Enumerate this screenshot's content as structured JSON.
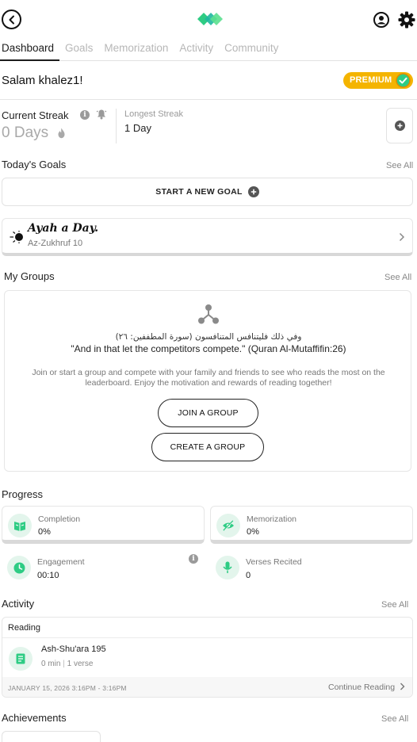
{
  "tabs": [
    "Dashboard",
    "Goals",
    "Memorization",
    "Activity",
    "Community"
  ],
  "greeting": "Salam khalez1!",
  "premium_label": "PREMIUM",
  "streak": {
    "current_label": "Current Streak",
    "current_value": "0 Days",
    "longest_label": "Longest Streak",
    "longest_value": "1 Day"
  },
  "goals": {
    "title": "Today's Goals",
    "see_all": "See All",
    "new_goal": "START A NEW GOAL"
  },
  "ayah": {
    "title": "Ayah a Day.",
    "reference": "Az-Zukhruf 10"
  },
  "groups": {
    "title": "My Groups",
    "see_all": "See All",
    "arabic": "وفي ذلك فليتنافس المتنافسون (سورة المطففين: ٢٦)",
    "quote": "\"And in that let the competitors compete.\" (Quran Al-Mutaffifin:26)",
    "description": "Join or start a group and compete with your family and friends to see who reads the most on the leaderboard. Enjoy the motivation and rewards of reading together!",
    "join_label": "JOIN A GROUP",
    "create_label": "CREATE A GROUP"
  },
  "progress": {
    "title": "Progress",
    "completion_label": "Completion",
    "completion_value": "0%",
    "memorization_label": "Memorization",
    "memorization_value": "0%",
    "engagement_label": "Engagement",
    "engagement_value": "00:10",
    "verses_label": "Verses Recited",
    "verses_value": "0"
  },
  "activity": {
    "title": "Activity",
    "see_all": "See All",
    "category": "Reading",
    "item_title": "Ash-Shu'ara 195",
    "item_duration": "0 min",
    "item_verses": "1 verse",
    "date_range": "JANUARY 15, 2026 3:16PM - 3:16PM",
    "continue_label": "Continue Reading"
  },
  "achievements": {
    "title": "Achievements",
    "see_all": "See All"
  },
  "colors": {
    "accent_green": "#2ecc84",
    "premium": "#f4b400",
    "icon_bg": "#e3f5ec"
  },
  "icons": [
    "back-arrow-icon",
    "logo-icon",
    "profile-icon",
    "gear-icon",
    "check-badge-icon",
    "info-icon",
    "bell-icon",
    "flame-icon",
    "plus-icon",
    "sun-icon",
    "chevron-right-icon",
    "share-nodes-icon",
    "book-icon",
    "eye-off-icon",
    "clock-icon",
    "microphone-icon"
  ]
}
